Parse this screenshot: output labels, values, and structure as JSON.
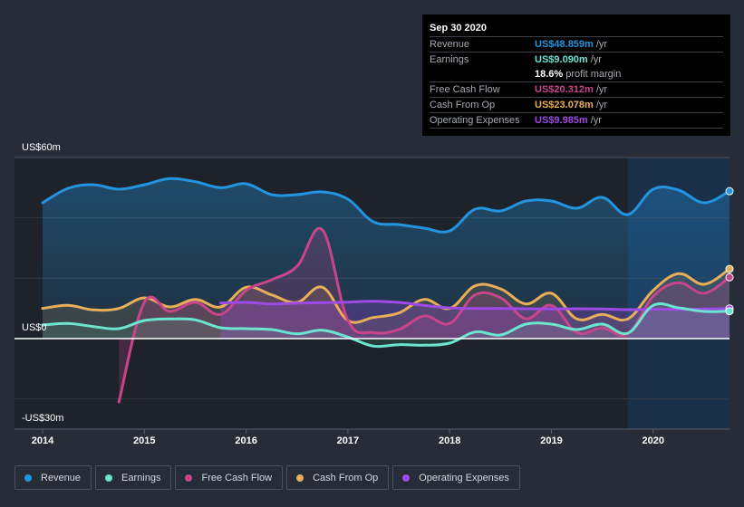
{
  "tooltip": {
    "date": "Sep 30 2020",
    "rows": [
      {
        "label": "Revenue",
        "value": "US$48.859m",
        "unit": "/yr",
        "color": "#2394df"
      },
      {
        "label": "Earnings",
        "value": "US$9.090m",
        "unit": "/yr",
        "color": "#6ce5d0"
      },
      {
        "label": "",
        "value": "18.6%",
        "unit": "profit margin",
        "color": "#ffffff"
      },
      {
        "label": "Free Cash Flow",
        "value": "US$20.312m",
        "unit": "/yr",
        "color": "#c9458b"
      },
      {
        "label": "Cash From Op",
        "value": "US$23.078m",
        "unit": "/yr",
        "color": "#e8ae5a"
      },
      {
        "label": "Operating Expenses",
        "value": "US$9.985m",
        "unit": "/yr",
        "color": "#9d4ae6"
      }
    ]
  },
  "legend": [
    {
      "label": "Revenue",
      "color": "#2394df"
    },
    {
      "label": "Earnings",
      "color": "#6ce5d0"
    },
    {
      "label": "Free Cash Flow",
      "color": "#c9458b"
    },
    {
      "label": "Cash From Op",
      "color": "#e8ae5a"
    },
    {
      "label": "Operating Expenses",
      "color": "#9d4ae6"
    }
  ],
  "chart_data": {
    "type": "area",
    "title": "",
    "xlabel": "",
    "ylabel": "",
    "ylim": [
      -30,
      60
    ],
    "xlim": [
      2013.85,
      2020.75
    ],
    "y_ticks": [
      {
        "value": 60,
        "label": "US$60m"
      },
      {
        "value": 0,
        "label": "US$0"
      },
      {
        "value": -30,
        "label": "-US$30m"
      }
    ],
    "gridlines": [
      60,
      40,
      20,
      0,
      -20
    ],
    "x_ticks": [
      {
        "value": 2014,
        "label": "2014"
      },
      {
        "value": 2015,
        "label": "2015"
      },
      {
        "value": 2016,
        "label": "2016"
      },
      {
        "value": 2017,
        "label": "2017"
      },
      {
        "value": 2018,
        "label": "2018"
      },
      {
        "value": 2019,
        "label": "2019"
      },
      {
        "value": 2020,
        "label": "2020"
      }
    ],
    "highlight_region": [
      2019.75,
      2020.75
    ],
    "legend_position": "bottom",
    "series": [
      {
        "name": "Revenue",
        "color": "#2394df",
        "x": [
          2014.0,
          2014.25,
          2014.5,
          2014.75,
          2015.0,
          2015.25,
          2015.5,
          2015.75,
          2016.0,
          2016.25,
          2016.5,
          2016.75,
          2017.0,
          2017.25,
          2017.5,
          2017.75,
          2018.0,
          2018.25,
          2018.5,
          2018.75,
          2019.0,
          2019.25,
          2019.5,
          2019.75,
          2020.0,
          2020.25,
          2020.5,
          2020.75
        ],
        "values": [
          45.0,
          49.8,
          51.0,
          49.5,
          51.0,
          53.0,
          52.0,
          50.0,
          51.3,
          47.7,
          47.7,
          48.6,
          46.2,
          38.7,
          37.8,
          36.6,
          35.7,
          42.9,
          42.3,
          45.6,
          45.6,
          43.2,
          46.8,
          41.1,
          49.5,
          49.2,
          45.0,
          48.859
        ]
      },
      {
        "name": "Earnings",
        "color": "#6ce5d0",
        "x": [
          2014.0,
          2014.25,
          2014.5,
          2014.75,
          2015.0,
          2015.25,
          2015.5,
          2015.75,
          2016.0,
          2016.25,
          2016.5,
          2016.75,
          2017.0,
          2017.25,
          2017.5,
          2017.75,
          2018.0,
          2018.25,
          2018.5,
          2018.75,
          2019.0,
          2019.25,
          2019.5,
          2019.75,
          2020.0,
          2020.25,
          2020.5,
          2020.75
        ],
        "values": [
          4.5,
          5.0,
          4.0,
          3.3,
          6.0,
          6.5,
          6.2,
          3.6,
          3.3,
          3.0,
          1.6,
          2.8,
          0.5,
          -2.5,
          -2.0,
          -2.2,
          -1.5,
          2.2,
          1.2,
          4.8,
          4.8,
          3.0,
          4.8,
          1.8,
          11.0,
          10.2,
          9.0,
          9.09
        ]
      },
      {
        "name": "Free Cash Flow",
        "color": "#c9458b",
        "x": [
          2014.75,
          2015.0,
          2015.25,
          2015.5,
          2015.75,
          2016.0,
          2016.25,
          2016.5,
          2016.75,
          2017.0,
          2017.25,
          2017.5,
          2017.75,
          2018.0,
          2018.25,
          2018.5,
          2018.75,
          2019.0,
          2019.25,
          2019.5,
          2019.75,
          2020.0,
          2020.25,
          2020.5,
          2020.75
        ],
        "values": [
          -21.0,
          12.0,
          9.0,
          12.0,
          8.0,
          16.0,
          19.5,
          24.0,
          36.0,
          6.0,
          2.0,
          3.0,
          7.5,
          5.0,
          14.5,
          13.5,
          6.6,
          11.0,
          2.0,
          3.5,
          1.5,
          14.0,
          18.5,
          15.0,
          20.312
        ]
      },
      {
        "name": "Cash From Op",
        "color": "#e8ae5a",
        "x": [
          2014.0,
          2014.25,
          2014.5,
          2014.75,
          2015.0,
          2015.25,
          2015.5,
          2015.75,
          2016.0,
          2016.25,
          2016.5,
          2016.75,
          2017.0,
          2017.25,
          2017.5,
          2017.75,
          2018.0,
          2018.25,
          2018.5,
          2018.75,
          2019.0,
          2019.25,
          2019.5,
          2019.75,
          2020.0,
          2020.25,
          2020.5,
          2020.75
        ],
        "values": [
          10.0,
          11.0,
          9.5,
          10.0,
          13.5,
          10.5,
          13.0,
          10.5,
          17.0,
          14.5,
          12.0,
          17.0,
          6.0,
          7.0,
          8.5,
          13.0,
          10.0,
          17.5,
          16.5,
          11.5,
          15.0,
          6.5,
          8.0,
          6.5,
          16.0,
          21.5,
          18.0,
          23.078
        ]
      },
      {
        "name": "Operating Expenses",
        "color": "#9d4ae6",
        "x": [
          2015.75,
          2016.0,
          2016.25,
          2016.5,
          2016.75,
          2017.0,
          2017.25,
          2017.5,
          2017.75,
          2018.0,
          2018.25,
          2018.5,
          2018.75,
          2019.0,
          2019.25,
          2019.5,
          2019.75,
          2020.0,
          2020.25,
          2020.5,
          2020.75
        ],
        "values": [
          11.8,
          12.0,
          11.5,
          11.8,
          11.9,
          12.1,
          12.4,
          12.0,
          11.0,
          10.2,
          10.0,
          10.0,
          9.9,
          9.8,
          9.9,
          9.8,
          9.6,
          9.7,
          9.7,
          9.8,
          9.985
        ]
      }
    ]
  }
}
